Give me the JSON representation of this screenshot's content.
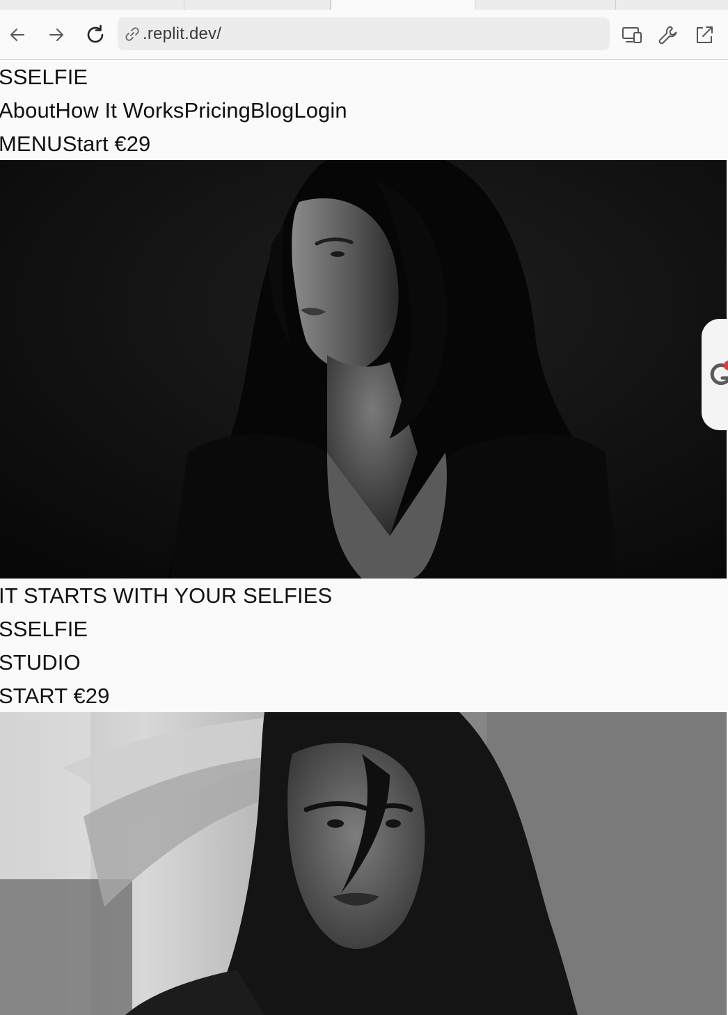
{
  "browser": {
    "url": ".replit.dev/"
  },
  "site": {
    "logo": "SSELFIE",
    "nav_links": [
      "About",
      "How It Works",
      "Pricing",
      "Blog",
      "Login"
    ],
    "menu_label": "MENU",
    "cta_header": "Start €29"
  },
  "hero": {
    "photo_alt": "Black and white portrait of a woman with long dark wavy hair looking to the side"
  },
  "section": {
    "tagline": "IT STARTS WITH YOUR SELFIES",
    "brand_line1": "SSELFIE",
    "brand_line2": "STUDIO",
    "cta": "START €29"
  },
  "second_photo": {
    "photo_alt": "Black and white portrait of a woman with windblown hair"
  },
  "icons": {
    "back": "arrow-left-icon",
    "forward": "arrow-right-icon",
    "reload": "reload-icon",
    "link": "link-icon",
    "devices": "devices-icon",
    "tools": "wrench-icon",
    "open": "external-link-icon"
  }
}
